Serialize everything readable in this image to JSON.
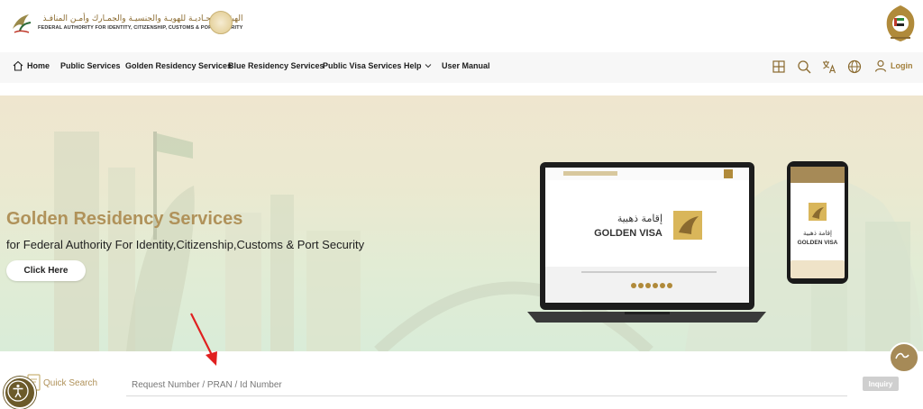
{
  "header": {
    "logo": {
      "arabic_name": "الهيئـة الاتحـاديـة للهويـة والجنسيـة والجمـارك وأمـن المنافـذ",
      "english_name": "FEDERAL AUTHORITY FOR IDENTITY, CITIZENSHIP, CUSTOMS & PORT SECURITY"
    },
    "seal_icon": "quality-seal",
    "emblem_icon": "uae-emblem"
  },
  "nav": {
    "items": [
      {
        "label": "Home",
        "icon": "home-icon"
      },
      {
        "label": "Public Services"
      },
      {
        "label": "Golden Residency Services"
      },
      {
        "label": "Blue Residency Services"
      },
      {
        "label": "Public Visa Services"
      },
      {
        "label": "Help",
        "icon": "chevron-down-icon"
      },
      {
        "label": "User Manual"
      }
    ],
    "right_icons": [
      "grid-icon",
      "search-icon",
      "translate-icon",
      "globe-icon"
    ],
    "login_label": "Login"
  },
  "hero": {
    "title": "Golden Residency Services",
    "subtitle": "for Federal Authority For Identity,Citizenship,Customs & Port Security",
    "cta_label": "Click Here",
    "laptop_logo_ar": "إقامة ذهبية",
    "laptop_logo_en": "GOLDEN VISA",
    "phone_logo_ar": "إقامة ذهبية",
    "phone_logo_en": "GOLDEN VISA"
  },
  "search": {
    "label": "Quick Search",
    "placeholder": "Request Number / PRAN / Id Number",
    "button_label": "Inquiry"
  },
  "colors": {
    "gold": "#b0925a",
    "accent": "#a27f3b",
    "annotation_arrow": "#e0201f"
  }
}
